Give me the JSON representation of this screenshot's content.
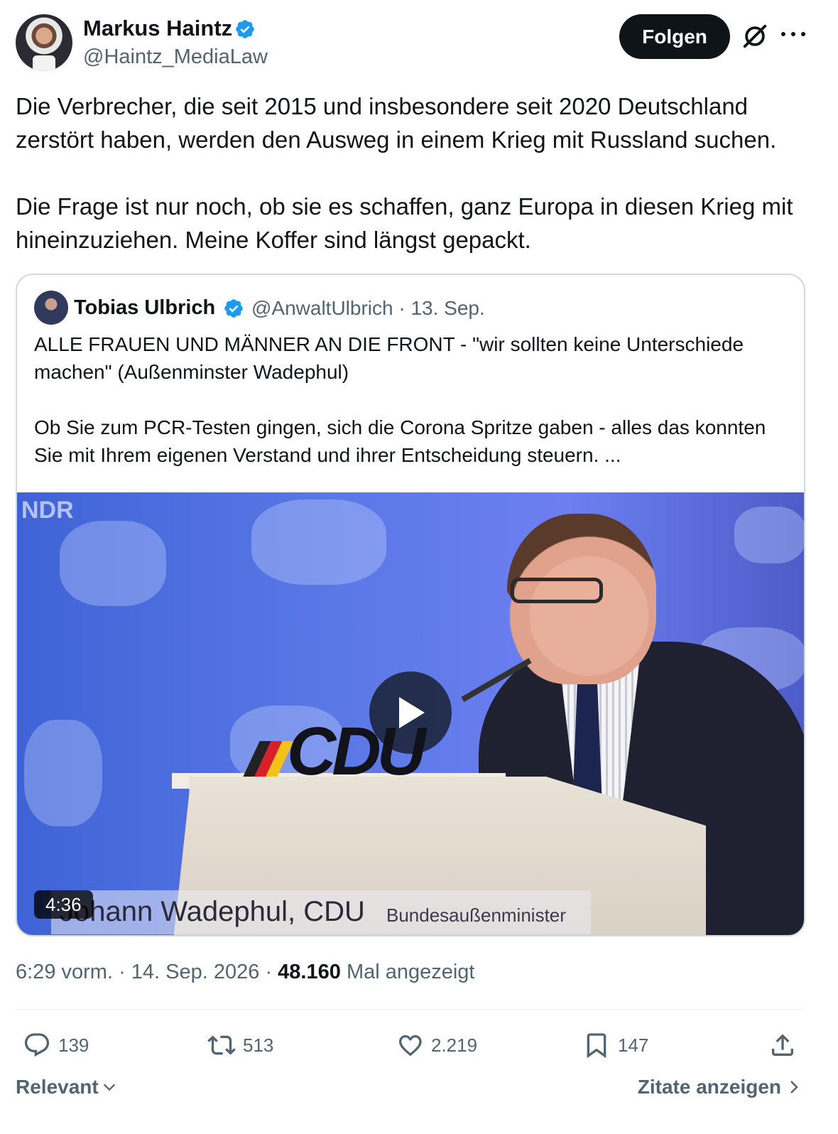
{
  "author": {
    "name": "Markus Haintz",
    "handle": "@Haintz_MediaLaw",
    "verified": true
  },
  "follow_label": "Folgen",
  "tweet": {
    "paragraphs": [
      "Die Verbrecher, die seit 2015 und insbesondere seit 2020 Deutschland zerstört haben, werden den Ausweg in einem Krieg mit Russland suchen.",
      "Die Frage ist nur noch, ob sie es schaffen, ganz Europa in diesen Krieg mit hineinzuziehen. Meine Koffer sind längst gepackt."
    ]
  },
  "quote": {
    "name": "Tobias Ulbrich",
    "meta": "@AnwaltUlbrich · 13. Sep.",
    "paragraphs": [
      "ALLE FRAUEN UND MÄNNER AN DIE FRONT - \"wir sollten keine Unterschiede machen\" (Außenminster Wadephul)",
      "Ob Sie zum PCR-Testen gingen, sich die Corona Spritze gaben - alles das konnten Sie mit Ihrem eigenen Verstand und ihrer Entscheidung steuern. ..."
    ],
    "video": {
      "duration": "4:36",
      "watermark": "NDR",
      "podium_logo": "CDU",
      "caption_name": "Johann Wadephul, CDU",
      "caption_role": "Bundesaußenminister"
    }
  },
  "meta": {
    "time": "6:29 vorm.",
    "date": "14. Sep. 2026",
    "views": "48.160",
    "views_label": "Mal angezeigt"
  },
  "actions": {
    "replies": "139",
    "reposts": "513",
    "likes": "2.219",
    "bookmarks": "147"
  },
  "footer": {
    "sort_label": "Relevant",
    "quotes_link": "Zitate anzeigen"
  },
  "icons": [
    "verified-badge-icon",
    "grok-icon",
    "more-icon",
    "play-icon",
    "reply-icon",
    "repost-icon",
    "like-icon",
    "bookmark-icon",
    "share-icon",
    "chevron-down-icon",
    "chevron-right-icon"
  ],
  "colors": {
    "text": "#0f1419",
    "secondary": "#536471",
    "verified": "#1d9bf0",
    "border": "#cfd9de"
  }
}
